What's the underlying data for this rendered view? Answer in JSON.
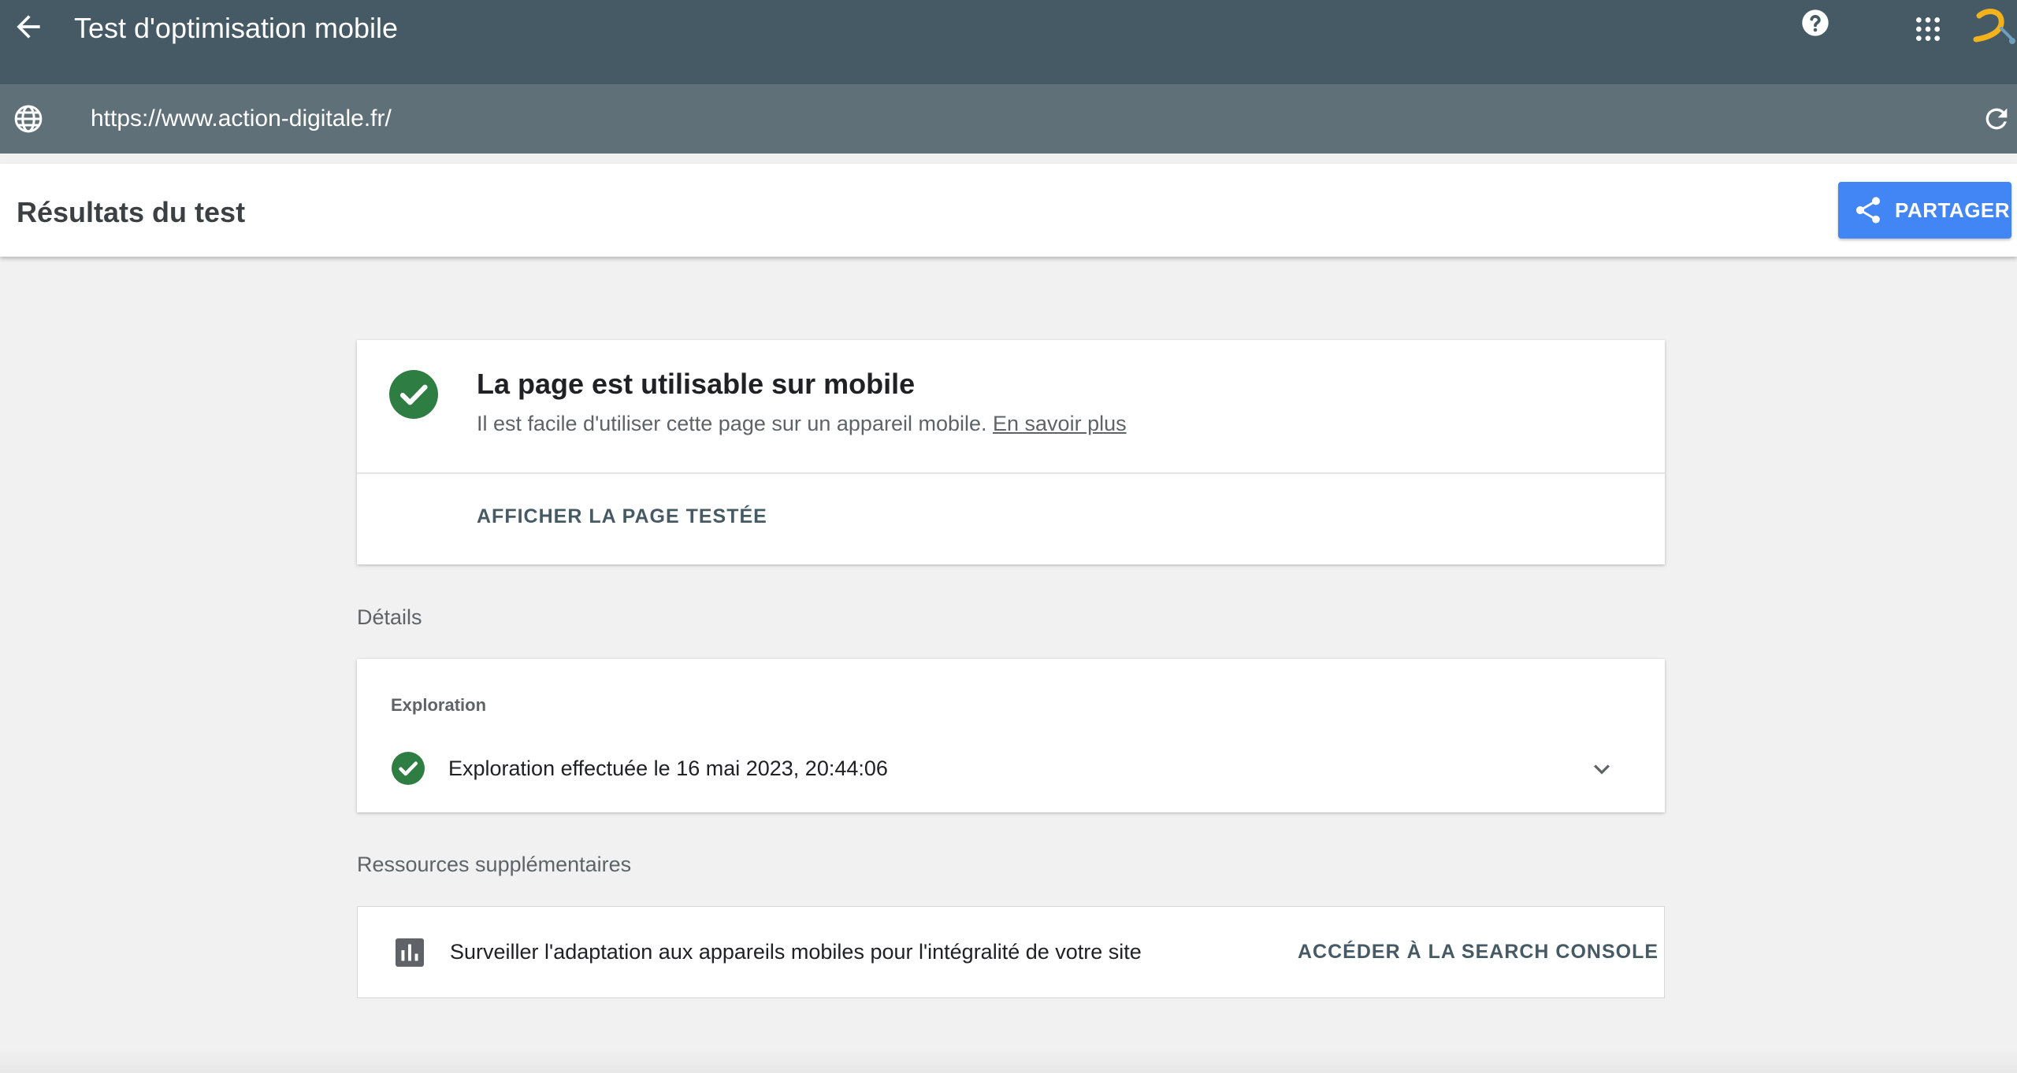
{
  "app": {
    "title": "Test d'optimisation mobile"
  },
  "url_bar": {
    "url": "https://www.action-digitale.fr/"
  },
  "results_header": {
    "title": "Résultats du test",
    "share_label": "PARTAGER"
  },
  "status_card": {
    "title": "La page est utilisable sur mobile",
    "description": "Il est facile d'utiliser cette page sur un appareil mobile.",
    "learn_more": "En savoir plus",
    "view_tested_label": "AFFICHER LA PAGE TESTÉE"
  },
  "details": {
    "section_label": "Détails",
    "crawl_heading": "Exploration",
    "crawl_text": "Exploration effectuée le 16 mai 2023, 20:44:06"
  },
  "resources": {
    "section_label": "Ressources supplémentaires",
    "text": "Surveiller l'adaptation aux appareils mobiles pour l'intégralité de votre site",
    "console_label": "ACCÉDER À LA SEARCH CONSOLE"
  },
  "icons": {
    "back": "arrow-back-icon",
    "help": "help-icon",
    "apps": "apps-grid-icon",
    "globe": "globe-icon",
    "refresh": "refresh-icon",
    "share": "share-icon",
    "success": "check-circle-icon",
    "expand": "chevron-down-icon",
    "chart": "bar-chart-icon"
  },
  "colors": {
    "topbar": "#455a64",
    "urlbar": "#607079",
    "accent": "#4285f4",
    "success": "#2e7d43",
    "logo": "#f2b21b"
  }
}
